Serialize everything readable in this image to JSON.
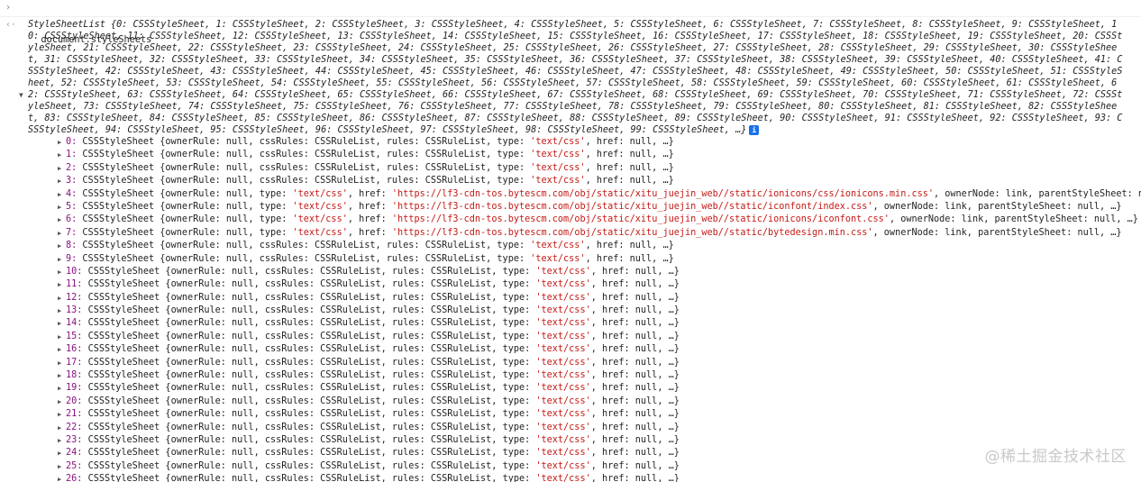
{
  "console": {
    "input_prompt": "›",
    "input_expression": "document.styleSheets",
    "result_arrow": "‹·",
    "expand_glyph": "▼",
    "summary": "StyleSheetList {0: CSSStyleSheet, 1: CSSStyleSheet, 2: CSSStyleSheet, 3: CSSStyleSheet, 4: CSSStyleSheet, 5: CSSStyleSheet, 6: CSSStyleSheet, 7: CSSStyleSheet, 8: CSSStyleSheet, 9: CSSStyleSheet, 10: CSSStyleSheet, 11: CSSStyleSheet, 12: CSSStyleSheet, 13: CSSStyleSheet, 14: CSSStyleSheet, 15: CSSStyleSheet, 16: CSSStyleSheet, 17: CSSStyleSheet, 18: CSSStyleSheet, 19: CSSStyleSheet, 20: CSSStyleSheet, 21: CSSStyleSheet, 22: CSSStyleSheet, 23: CSSStyleSheet, 24: CSSStyleSheet, 25: CSSStyleSheet, 26: CSSStyleSheet, 27: CSSStyleSheet, 28: CSSStyleSheet, 29: CSSStyleSheet, 30: CSSStyleSheet, 31: CSSStyleSheet, 32: CSSStyleSheet, 33: CSSStyleSheet, 34: CSSStyleSheet, 35: CSSStyleSheet, 36: CSSStyleSheet, 37: CSSStyleSheet, 38: CSSStyleSheet, 39: CSSStyleSheet, 40: CSSStyleSheet, 41: CSSStyleSheet, 42: CSSStyleSheet, 43: CSSStyleSheet, 44: CSSStyleSheet, 45: CSSStyleSheet, 46: CSSStyleSheet, 47: CSSStyleSheet, 48: CSSStyleSheet, 49: CSSStyleSheet, 50: CSSStyleSheet, 51: CSSStyleSheet, 52: CSSStyleSheet, 53: CSSStyleSheet, 54: CSSStyleSheet, 55: CSSStyleSheet, 56: CSSStyleSheet, 57: CSSStyleSheet, 58: CSSStyleSheet, 59: CSSStyleSheet, 60: CSSStyleSheet, 61: CSSStyleSheet, 62: CSSStyleSheet, 63: CSSStyleSheet, 64: CSSStyleSheet, 65: CSSStyleSheet, 66: CSSStyleSheet, 67: CSSStyleSheet, 68: CSSStyleSheet, 69: CSSStyleSheet, 70: CSSStyleSheet, 71: CSSStyleSheet, 72: CSSStyleSheet, 73: CSSStyleSheet, 74: CSSStyleSheet, 75: CSSStyleSheet, 76: CSSStyleSheet, 77: CSSStyleSheet, 78: CSSStyleSheet, 79: CSSStyleSheet, 80: CSSStyleSheet, 81: CSSStyleSheet, 82: CSSStyleSheet, 83: CSSStyleSheet, 84: CSSStyleSheet, 85: CSSStyleSheet, 86: CSSStyleSheet, 87: CSSStyleSheet, 88: CSSStyleSheet, 89: CSSStyleSheet, 90: CSSStyleSheet, 91: CSSStyleSheet, 92: CSSStyleSheet, 93: CSSStyleSheet, 94: CSSStyleSheet, 95: CSSStyleSheet, 96: CSSStyleSheet, 97: CSSStyleSheet, 98: CSSStyleSheet, 99: CSSStyleSheet, …}",
    "info_badge": "i",
    "entries": [
      {
        "index": "0",
        "pre": "CSSStyleSheet {ownerRule: null, cssRules: CSSRuleList, rules: CSSRuleList, type: ",
        "str1": "'text/css'",
        "mid": ", href: null, …}",
        "str2": "",
        "post": ""
      },
      {
        "index": "1",
        "pre": "CSSStyleSheet {ownerRule: null, cssRules: CSSRuleList, rules: CSSRuleList, type: ",
        "str1": "'text/css'",
        "mid": ", href: null, …}",
        "str2": "",
        "post": ""
      },
      {
        "index": "2",
        "pre": "CSSStyleSheet {ownerRule: null, cssRules: CSSRuleList, rules: CSSRuleList, type: ",
        "str1": "'text/css'",
        "mid": ", href: null, …}",
        "str2": "",
        "post": ""
      },
      {
        "index": "3",
        "pre": "CSSStyleSheet {ownerRule: null, cssRules: CSSRuleList, rules: CSSRuleList, type: ",
        "str1": "'text/css'",
        "mid": ", href: null, …}",
        "str2": "",
        "post": ""
      },
      {
        "index": "4",
        "pre": "CSSStyleSheet {ownerRule: null, type: ",
        "str1": "'text/css'",
        "mid": ", href: ",
        "str2": "'https://lf3-cdn-tos.bytescm.com/obj/static/xitu_juejin_web//static/ionicons/css/ionicons.min.css'",
        "post": ", ownerNode: link, parentStyleSheet: null, …}"
      },
      {
        "index": "5",
        "pre": "CSSStyleSheet {ownerRule: null, type: ",
        "str1": "'text/css'",
        "mid": ", href: ",
        "str2": "'https://lf3-cdn-tos.bytescm.com/obj/static/xitu_juejin_web//static/iconfont/index.css'",
        "post": ", ownerNode: link, parentStyleSheet: null, …}"
      },
      {
        "index": "6",
        "pre": "CSSStyleSheet {ownerRule: null, type: ",
        "str1": "'text/css'",
        "mid": ", href: ",
        "str2": "'https://lf3-cdn-tos.bytescm.com/obj/static/xitu_juejin_web//static/ionicons/iconfont.css'",
        "post": ", ownerNode: link, parentStyleSheet: null, …}"
      },
      {
        "index": "7",
        "pre": "CSSStyleSheet {ownerRule: null, type: ",
        "str1": "'text/css'",
        "mid": ", href: ",
        "str2": "'https://lf3-cdn-tos.bytescm.com/obj/static/xitu_juejin_web//static/bytedesign.min.css'",
        "post": ", ownerNode: link, parentStyleSheet: null, …}"
      },
      {
        "index": "8",
        "pre": "CSSStyleSheet {ownerRule: null, cssRules: CSSRuleList, rules: CSSRuleList, type: ",
        "str1": "'text/css'",
        "mid": ", href: null, …}",
        "str2": "",
        "post": ""
      },
      {
        "index": "9",
        "pre": "CSSStyleSheet {ownerRule: null, cssRules: CSSRuleList, rules: CSSRuleList, type: ",
        "str1": "'text/css'",
        "mid": ", href: null, …}",
        "str2": "",
        "post": ""
      },
      {
        "index": "10",
        "pre": "CSSStyleSheet {ownerRule: null, cssRules: CSSRuleList, rules: CSSRuleList, type: ",
        "str1": "'text/css'",
        "mid": ", href: null, …}",
        "str2": "",
        "post": ""
      },
      {
        "index": "11",
        "pre": "CSSStyleSheet {ownerRule: null, cssRules: CSSRuleList, rules: CSSRuleList, type: ",
        "str1": "'text/css'",
        "mid": ", href: null, …}",
        "str2": "",
        "post": ""
      },
      {
        "index": "12",
        "pre": "CSSStyleSheet {ownerRule: null, cssRules: CSSRuleList, rules: CSSRuleList, type: ",
        "str1": "'text/css'",
        "mid": ", href: null, …}",
        "str2": "",
        "post": ""
      },
      {
        "index": "13",
        "pre": "CSSStyleSheet {ownerRule: null, cssRules: CSSRuleList, rules: CSSRuleList, type: ",
        "str1": "'text/css'",
        "mid": ", href: null, …}",
        "str2": "",
        "post": ""
      },
      {
        "index": "14",
        "pre": "CSSStyleSheet {ownerRule: null, cssRules: CSSRuleList, rules: CSSRuleList, type: ",
        "str1": "'text/css'",
        "mid": ", href: null, …}",
        "str2": "",
        "post": ""
      },
      {
        "index": "15",
        "pre": "CSSStyleSheet {ownerRule: null, cssRules: CSSRuleList, rules: CSSRuleList, type: ",
        "str1": "'text/css'",
        "mid": ", href: null, …}",
        "str2": "",
        "post": ""
      },
      {
        "index": "16",
        "pre": "CSSStyleSheet {ownerRule: null, cssRules: CSSRuleList, rules: CSSRuleList, type: ",
        "str1": "'text/css'",
        "mid": ", href: null, …}",
        "str2": "",
        "post": ""
      },
      {
        "index": "17",
        "pre": "CSSStyleSheet {ownerRule: null, cssRules: CSSRuleList, rules: CSSRuleList, type: ",
        "str1": "'text/css'",
        "mid": ", href: null, …}",
        "str2": "",
        "post": ""
      },
      {
        "index": "18",
        "pre": "CSSStyleSheet {ownerRule: null, cssRules: CSSRuleList, rules: CSSRuleList, type: ",
        "str1": "'text/css'",
        "mid": ", href: null, …}",
        "str2": "",
        "post": ""
      },
      {
        "index": "19",
        "pre": "CSSStyleSheet {ownerRule: null, cssRules: CSSRuleList, rules: CSSRuleList, type: ",
        "str1": "'text/css'",
        "mid": ", href: null, …}",
        "str2": "",
        "post": ""
      },
      {
        "index": "20",
        "pre": "CSSStyleSheet {ownerRule: null, cssRules: CSSRuleList, rules: CSSRuleList, type: ",
        "str1": "'text/css'",
        "mid": ", href: null, …}",
        "str2": "",
        "post": ""
      },
      {
        "index": "21",
        "pre": "CSSStyleSheet {ownerRule: null, cssRules: CSSRuleList, rules: CSSRuleList, type: ",
        "str1": "'text/css'",
        "mid": ", href: null, …}",
        "str2": "",
        "post": ""
      },
      {
        "index": "22",
        "pre": "CSSStyleSheet {ownerRule: null, cssRules: CSSRuleList, rules: CSSRuleList, type: ",
        "str1": "'text/css'",
        "mid": ", href: null, …}",
        "str2": "",
        "post": ""
      },
      {
        "index": "23",
        "pre": "CSSStyleSheet {ownerRule: null, cssRules: CSSRuleList, rules: CSSRuleList, type: ",
        "str1": "'text/css'",
        "mid": ", href: null, …}",
        "str2": "",
        "post": ""
      },
      {
        "index": "24",
        "pre": "CSSStyleSheet {ownerRule: null, cssRules: CSSRuleList, rules: CSSRuleList, type: ",
        "str1": "'text/css'",
        "mid": ", href: null, …}",
        "str2": "",
        "post": ""
      },
      {
        "index": "25",
        "pre": "CSSStyleSheet {ownerRule: null, cssRules: CSSRuleList, rules: CSSRuleList, type: ",
        "str1": "'text/css'",
        "mid": ", href: null, …}",
        "str2": "",
        "post": ""
      },
      {
        "index": "26",
        "pre": "CSSStyleSheet {ownerRule: null, cssRules: CSSRuleList, rules: CSSRuleList, type: ",
        "str1": "'text/css'",
        "mid": ", href: null, …}",
        "str2": "",
        "post": ""
      }
    ],
    "entry_glyph": "▶"
  },
  "watermark": "@稀土掘金技术社区",
  "colors": {
    "index": "#881280",
    "string": "#c41a16",
    "info_badge": "#1a73e8"
  }
}
